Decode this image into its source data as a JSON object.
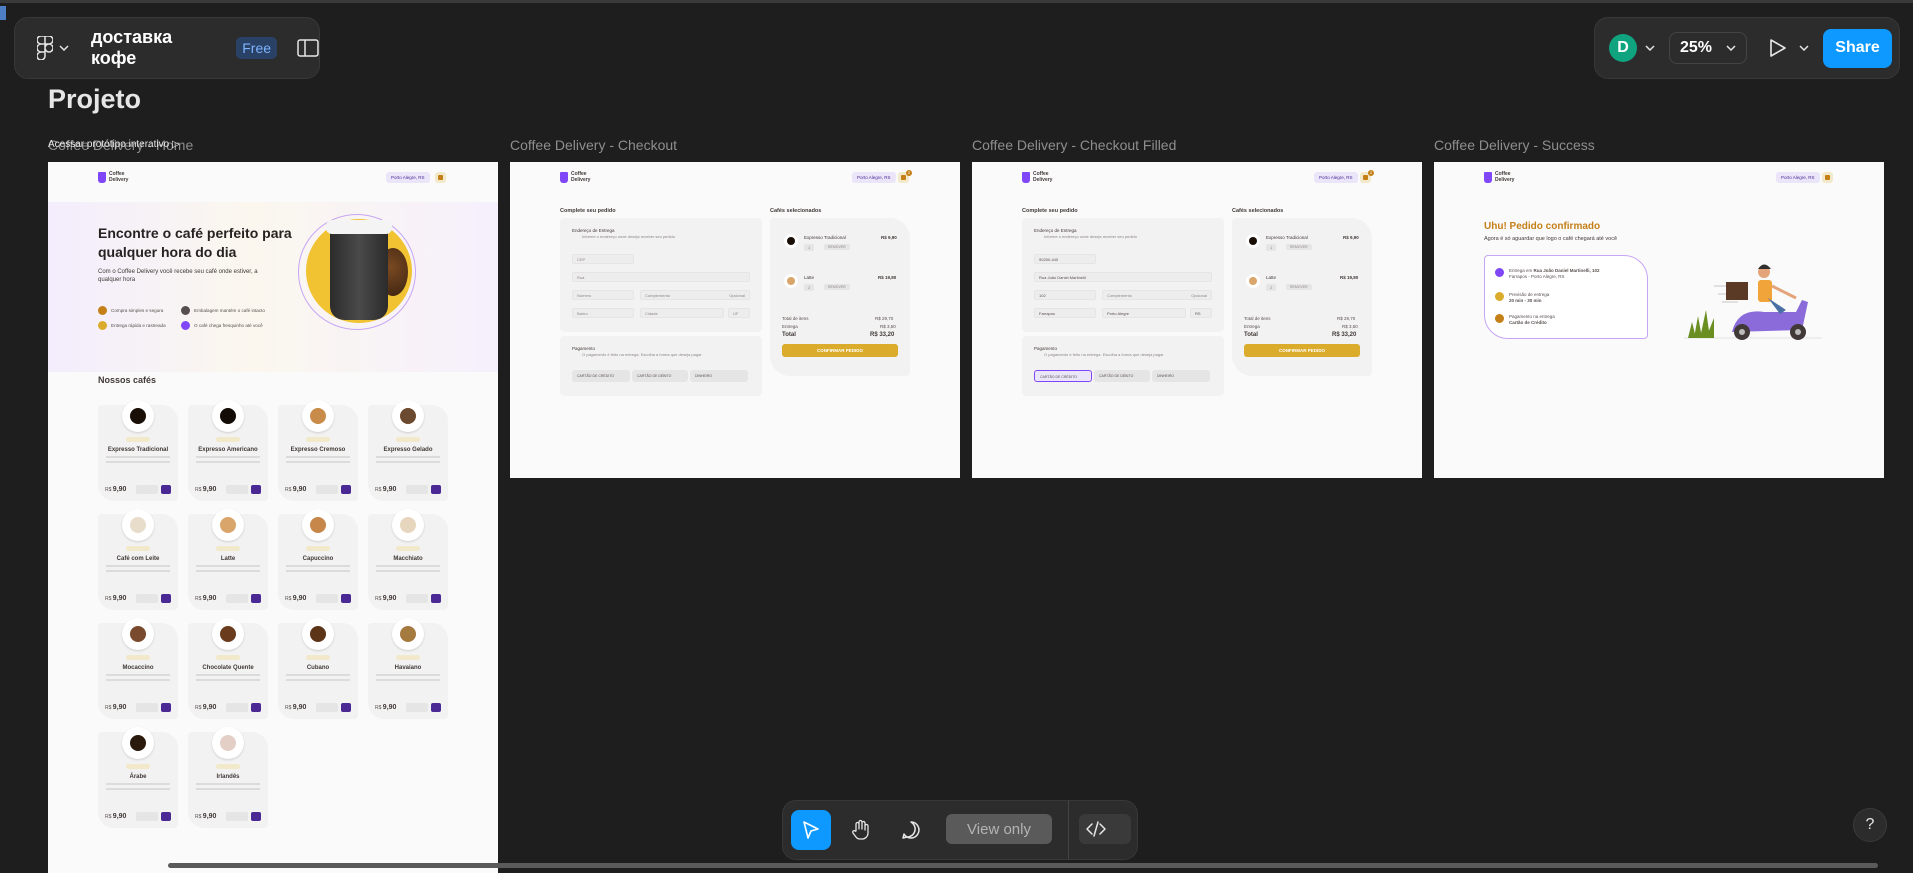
{
  "app": {
    "file_title": "доставка кофе",
    "plan_badge": "Free",
    "project_title": "Projeto",
    "prototype_link": "Acessar protótipo interativo ▷"
  },
  "header_right": {
    "avatar_initial": "D",
    "avatar_color": "#10a37f",
    "zoom_level": "25%",
    "share_label": "Share"
  },
  "frames": [
    {
      "label": "Coffee Delivery - Home"
    },
    {
      "label": "Coffee Delivery - Checkout"
    },
    {
      "label": "Coffee Delivery - Checkout Filled"
    },
    {
      "label": "Coffee Delivery - Success"
    }
  ],
  "mini_app": {
    "logo_line1": "Coffee",
    "logo_line2": "Delivery",
    "location": "Porto Alegre, RS",
    "cart_count": "2"
  },
  "home": {
    "hero_title": "Encontre o café perfeito para qualquer hora do dia",
    "hero_subtitle": "Com o Coffee Delivery você recebe seu café onde estiver, a qualquer hora",
    "benefits": [
      "Compra simples e segura",
      "Embalagem mantém o café intacto",
      "Entrega rápida e rastreada",
      "O café chega fresquinho até você"
    ],
    "section_title": "Nossos cafés",
    "currency": "R$",
    "coffees": [
      {
        "name": "Expresso Tradicional",
        "price": "9,90"
      },
      {
        "name": "Expresso Americano",
        "price": "9,90"
      },
      {
        "name": "Expresso Cremoso",
        "price": "9,90"
      },
      {
        "name": "Expresso Gelado",
        "price": "9,90"
      },
      {
        "name": "Café com Leite",
        "price": "9,90"
      },
      {
        "name": "Latte",
        "price": "9,90"
      },
      {
        "name": "Capuccino",
        "price": "9,90"
      },
      {
        "name": "Macchiato",
        "price": "9,90"
      },
      {
        "name": "Mocaccino",
        "price": "9,90"
      },
      {
        "name": "Chocolate Quente",
        "price": "9,90"
      },
      {
        "name": "Cubano",
        "price": "9,90"
      },
      {
        "name": "Havaiano",
        "price": "9,90"
      },
      {
        "name": "Árabe",
        "price": "9,90"
      },
      {
        "name": "Irlandês",
        "price": "9,90"
      }
    ]
  },
  "checkout": {
    "form_title": "Complete seu pedido",
    "cart_title": "Cafés selecionados",
    "address_title": "Endereço de Entrega",
    "address_sub": "Informe o endereço onde deseja receber seu pedido",
    "payment_title": "Pagamento",
    "payment_sub": "O pagamento é feito na entrega. Escolha a forma que deseja pagar",
    "placeholders": [
      "CEP",
      "Rua",
      "Número",
      "Complemento",
      "Opcional",
      "Bairro",
      "Cidade",
      "UF"
    ],
    "filled_values": [
      "90250-440",
      "Rua João Daniel Martinelli",
      "102",
      "Complemento",
      "Opcional",
      "Farrapos",
      "Porto Alegre",
      "RS"
    ],
    "payment_options": [
      "CARTÃO DE CRÉDITO",
      "CARTÃO DE DÉBITO",
      "DINHEIRO"
    ],
    "items": [
      {
        "name": "Expresso Tradicional",
        "price": "R$ 9,90",
        "qty": "1",
        "remove": "REMOVER"
      },
      {
        "name": "Latte",
        "price": "R$ 19,80",
        "qty": "2",
        "remove": "REMOVER"
      }
    ],
    "totals": {
      "items_label": "Total de itens",
      "items_value": "R$ 29,70",
      "delivery_label": "Entrega",
      "delivery_value": "R$ 3,50",
      "total_label": "Total",
      "total_value": "R$ 33,20"
    },
    "confirm_label": "CONFIRMAR PEDIDO"
  },
  "success": {
    "title": "Uhu! Pedido confirmado",
    "subtitle": "Agora é só aguardar que logo o café chegará até você",
    "address_prefix": "Entrega em",
    "address_value": "Rua João Daniel Martinelli, 102",
    "address_line2": "Farrapos - Porto Alegre, RS",
    "eta_label": "Previsão de entrega",
    "eta_value": "20 min - 30 min",
    "payment_label": "Pagamento na entrega",
    "payment_value": "Cartão de Crédito"
  },
  "bottom_toolbar": {
    "view_only_label": "View only"
  },
  "help_label": "?",
  "colors": {
    "accent": "#0d99ff",
    "purple": "#8047f8",
    "purple_dark": "#4b2995",
    "yellow": "#dbac2c",
    "yellow_dark": "#c47f17"
  }
}
